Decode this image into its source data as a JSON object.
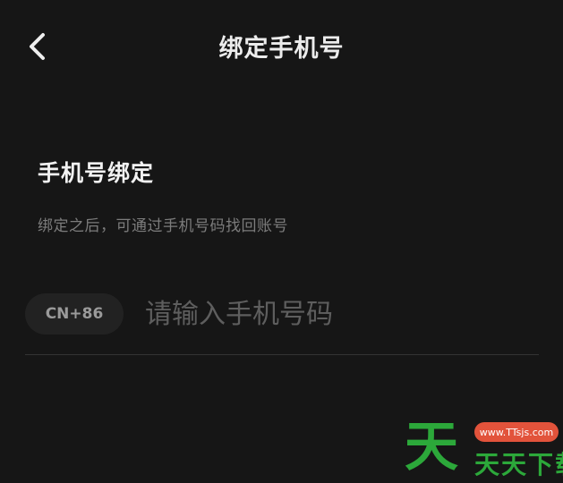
{
  "header": {
    "title": "绑定手机号",
    "back_icon": "chevron-left-icon"
  },
  "section": {
    "title": "手机号绑定",
    "description": "绑定之后，可通过手机号码找回账号"
  },
  "phone": {
    "country_code": "CN+86",
    "placeholder": "请输入手机号码",
    "value": ""
  },
  "watermark": {
    "big_char": "天",
    "url": "www.TTsjs.com",
    "text": "天天下载"
  },
  "colors": {
    "background": "#161616",
    "title_text": "#ececec",
    "secondary_text": "#7c7c7c",
    "placeholder_text": "#5e5e5e",
    "watermark_green": "#2ca83a",
    "watermark_red": "#e2533b"
  }
}
